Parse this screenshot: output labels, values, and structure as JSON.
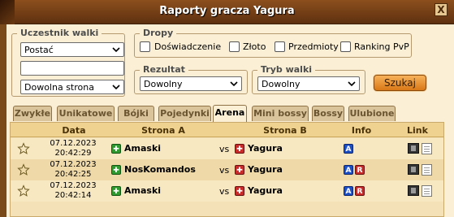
{
  "window": {
    "title": "Raporty gracza Yagura",
    "close_label": "X"
  },
  "filters": {
    "participant": {
      "legend": "Uczestnik walki",
      "type_value": "Postać",
      "name_value": "",
      "side_value": "Dowolna strona"
    },
    "drops": {
      "legend": "Dropy",
      "items": [
        "Doświadczenie",
        "Złoto",
        "Przedmioty",
        "Ranking PvP"
      ]
    },
    "result": {
      "legend": "Rezultat",
      "value": "Dowolny"
    },
    "mode": {
      "legend": "Tryb walki",
      "value": "Dowolny"
    },
    "search_label": "Szukaj"
  },
  "tabs": [
    "Zwykłe",
    "Unikatowe",
    "Bójki",
    "Pojedynki",
    "Arena",
    "Mini bossy",
    "Bossy",
    "Ulubione"
  ],
  "active_tab": "Arena",
  "table": {
    "headers": {
      "date": "Data",
      "side_a": "Strona A",
      "side_b": "Strona B",
      "info": "Info",
      "link": "Link"
    },
    "vs_label": "vs",
    "rows": [
      {
        "date": "07.12.2023",
        "time": "20:42:29",
        "side_a": "Amaski",
        "side_b": "Yagura",
        "info": [
          "A"
        ]
      },
      {
        "date": "07.12.2023",
        "time": "20:42:25",
        "side_a": "NosKomandos",
        "side_b": "Yagura",
        "info": [
          "A",
          "R"
        ]
      },
      {
        "date": "07.12.2023",
        "time": "20:42:14",
        "side_a": "Amaski",
        "side_b": "Yagura",
        "info": [
          "A",
          "R"
        ]
      }
    ]
  }
}
